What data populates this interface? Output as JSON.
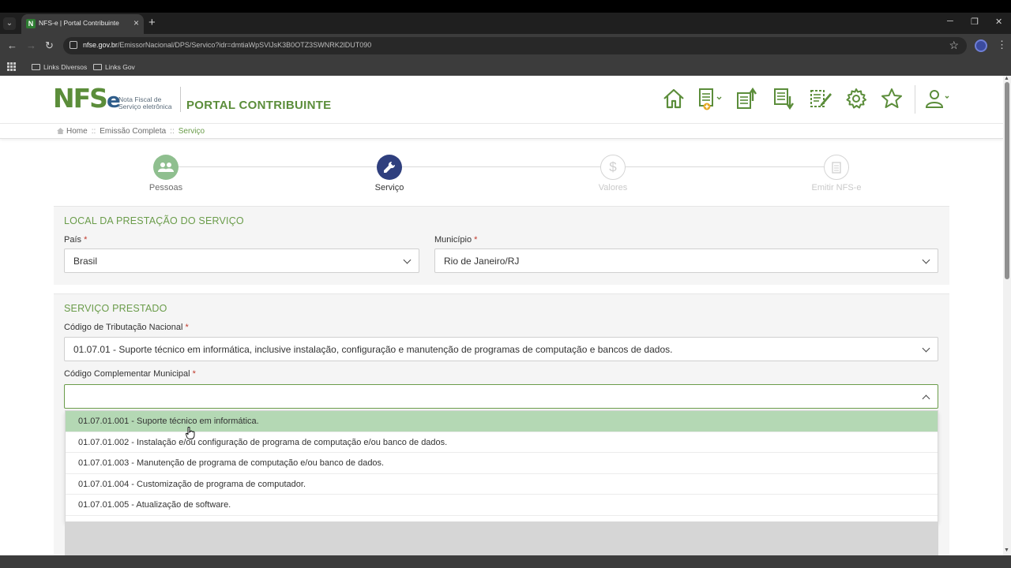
{
  "browser": {
    "tab_title": "NFS-e | Portal Contribuinte",
    "url_host": "nfse.gov.br",
    "url_path": "/EmissorNacional/DPS/Servico?idr=dmtiaWpSVlJsK3B0OTZ3SWNRK2lDUT090",
    "bookmarks": [
      "Links Diversos",
      "Links Gov"
    ]
  },
  "header": {
    "logo_text": "NFS",
    "logo_e": "e",
    "logo_sub_1": "Nota Fiscal de",
    "logo_sub_2": "Serviço eletrônica",
    "portal_title": "PORTAL CONTRIBUINTE",
    "icon_color": "#5b8d3a"
  },
  "breadcrumb": {
    "home": "Home",
    "level1": "Emissão Completa",
    "current": "Serviço"
  },
  "steps": [
    {
      "label": "Pessoas",
      "state": "done"
    },
    {
      "label": "Serviço",
      "state": "active"
    },
    {
      "label": "Valores",
      "state": "pending"
    },
    {
      "label": "Emitir NFS-e",
      "state": "pending"
    }
  ],
  "local": {
    "title": "LOCAL DA PRESTAÇÃO DO SERVIÇO",
    "pais_label": "País",
    "pais_value": "Brasil",
    "municipio_label": "Município",
    "municipio_value": "Rio de Janeiro/RJ",
    "required_mark": "*"
  },
  "servico": {
    "title": "SERVIÇO PRESTADO",
    "codigo_trib_label": "Código de Tributação Nacional",
    "codigo_trib_value": "01.07.01 - Suporte técnico em informática, inclusive instalação, configuração e manutenção de programas de computação e bancos de dados.",
    "codigo_comp_label": "Código Complementar Municipal",
    "codigo_comp_value": "",
    "options": [
      "01.07.01.001 - Suporte técnico em informática.",
      "01.07.01.002 - Instalação e/ou configuração de programa de computação e/ou banco de dados.",
      "01.07.01.003 - Manutenção de programa de computação e/ou banco de dados.",
      "01.07.01.004 - Customização de programa de computador.",
      "01.07.01.005 - Atualização de software."
    ],
    "highlight_color": "#b4d8b4"
  },
  "colors": {
    "brand_green": "#6a9c4a",
    "step_active": "#2f3f7e",
    "step_done": "#8fbf8f"
  }
}
